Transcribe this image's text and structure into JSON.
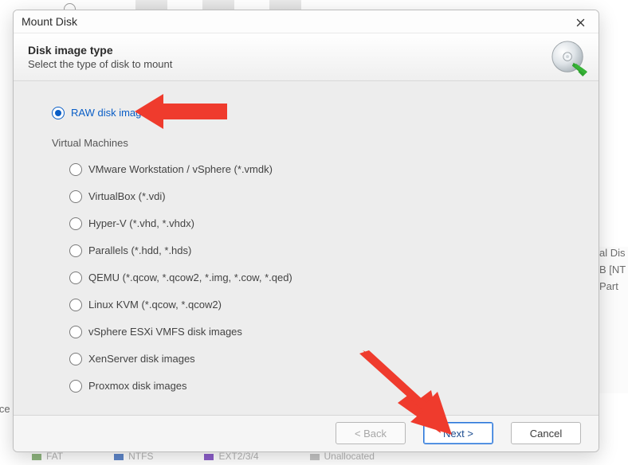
{
  "background": {
    "left_label": "ice",
    "right_lines": [
      "al Dis",
      "B [NT",
      "Part"
    ],
    "legend": [
      "FAT",
      "NTFS",
      "EXT2/3/4",
      "Unallocated"
    ]
  },
  "dialog": {
    "title": "Mount Disk",
    "header": {
      "heading": "Disk image type",
      "subheading": "Select the type of disk to mount"
    },
    "option_raw": "RAW disk images",
    "section_vm": "Virtual Machines",
    "vm_options": [
      "VMware Workstation / vSphere (*.vmdk)",
      "VirtualBox (*.vdi)",
      "Hyper-V (*.vhd, *.vhdx)",
      "Parallels (*.hdd, *.hds)",
      "QEMU (*.qcow, *.qcow2, *.img, *.cow, *.qed)",
      "Linux KVM (*.qcow, *.qcow2)",
      "vSphere ESXi VMFS disk images",
      "XenServer disk images",
      "Proxmox disk images"
    ],
    "buttons": {
      "back": "< Back",
      "next": "Next >",
      "cancel": "Cancel"
    }
  }
}
